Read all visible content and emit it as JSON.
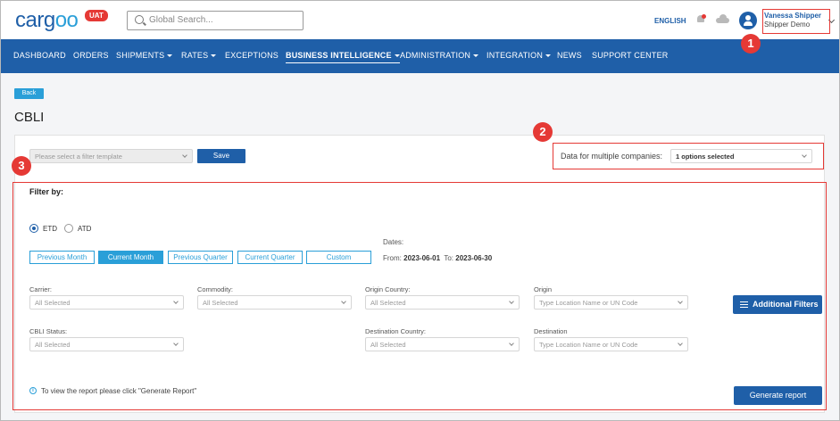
{
  "header": {
    "logo_a": "carg",
    "logo_b": "oo",
    "env_badge": "UAT",
    "search_placeholder": "Global Search...",
    "language": "ENGLISH",
    "user_name": "Vanessa Shipper",
    "company": "Shipper Demo"
  },
  "nav": [
    {
      "label": "DASHBOARD",
      "dropdown": false
    },
    {
      "label": "ORDERS",
      "dropdown": false
    },
    {
      "label": "SHIPMENTS",
      "dropdown": true
    },
    {
      "label": "RATES",
      "dropdown": true
    },
    {
      "label": "EXCEPTIONS",
      "dropdown": false
    },
    {
      "label": "BUSINESS INTELLIGENCE",
      "dropdown": true,
      "active": true
    },
    {
      "label": "ADMINISTRATION",
      "dropdown": true
    },
    {
      "label": "INTEGRATION",
      "dropdown": true
    },
    {
      "label": "NEWS",
      "dropdown": false
    },
    {
      "label": "SUPPORT CENTER",
      "dropdown": false
    }
  ],
  "page": {
    "back_label": "Back",
    "title": "CBLI"
  },
  "template": {
    "placeholder": "Please select a filter template",
    "save_label": "Save"
  },
  "companies": {
    "label": "Data for multiple companies:",
    "value": "1 options selected"
  },
  "annotations": [
    "1",
    "2",
    "3"
  ],
  "filters": {
    "title": "Filter by:",
    "radio_etd": "ETD",
    "radio_atd": "ATD",
    "selected_radio": "ETD",
    "periods": [
      "Previous Month",
      "Current Month",
      "Previous Quarter",
      "Current Quarter",
      "Custom"
    ],
    "active_period": "Current Month",
    "dates_label": "Dates:",
    "from_label": "From:",
    "from_value": "2023-06-01",
    "to_label": "To:",
    "to_value": "2023-06-30",
    "carrier_label": "Carrier:",
    "carrier_value": "All Selected",
    "commodity_label": "Commodity:",
    "commodity_value": "All Selected",
    "origin_country_label": "Origin Country:",
    "origin_country_value": "All Selected",
    "origin_label": "Origin",
    "origin_placeholder": "Type Location Name or UN Code",
    "cbli_status_label": "CBLI Status:",
    "cbli_status_value": "All Selected",
    "destination_country_label": "Destination Country:",
    "destination_country_value": "All Selected",
    "destination_label": "Destination",
    "destination_placeholder": "Type Location Name or UN Code",
    "additional_filters_label": "Additional Filters"
  },
  "footer": {
    "info_text": "To view the report please click \"Generate Report\"",
    "generate_label": "Generate report"
  },
  "colors": {
    "brand": "#1f5fa8",
    "accent": "#2a9fd8",
    "annotation": "#e53935"
  }
}
